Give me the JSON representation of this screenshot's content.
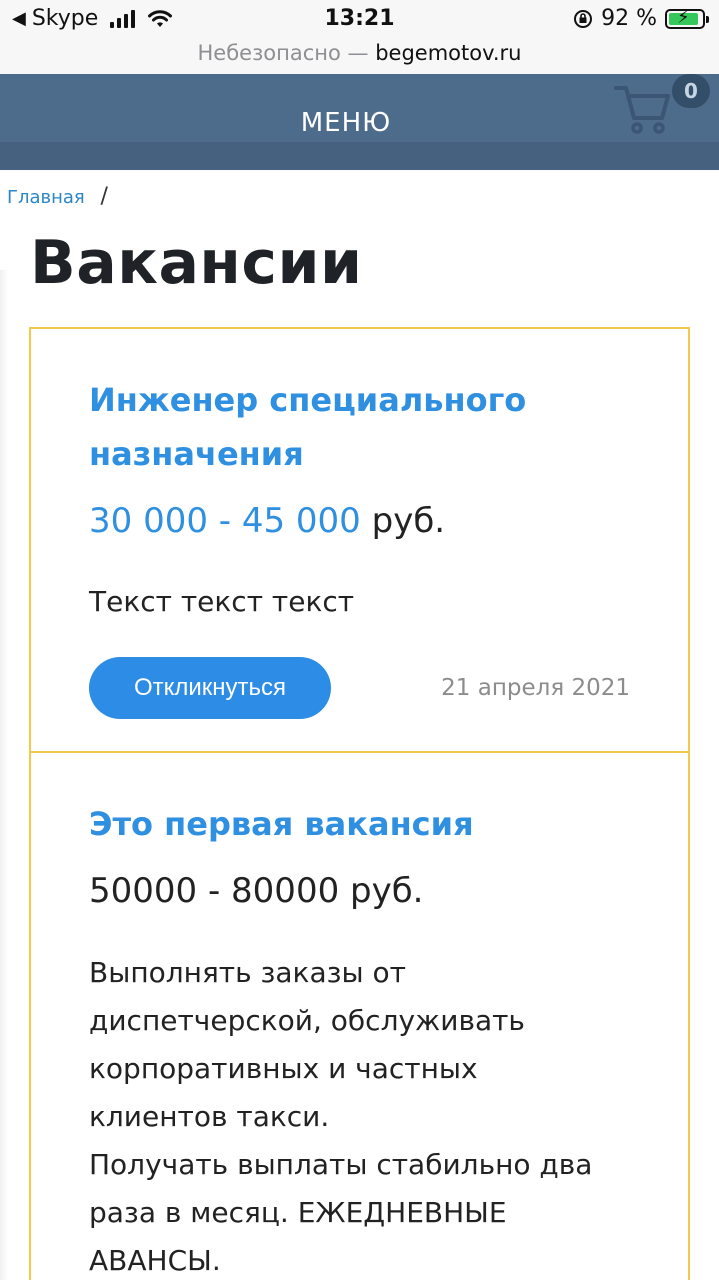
{
  "status_bar": {
    "back_app": "Skype",
    "time": "13:21",
    "battery_percent": "92 %",
    "battery_level": 0.92
  },
  "address_bar": {
    "security": "Небезопасно —",
    "domain": "begemotov.ru"
  },
  "header": {
    "menu_label": "МЕНЮ",
    "cart_count": "0"
  },
  "breadcrumb": {
    "home": "Главная",
    "separator": "/"
  },
  "page": {
    "title": "Вакансии"
  },
  "vacancies": [
    {
      "title": "Инженер специального назначения",
      "salary_range": "30 000 - 45 000",
      "currency": " руб.",
      "description": "Текст текст текст",
      "button_label": "Откликнуться",
      "date": "21 апреля 2021"
    },
    {
      "title": "Это первая вакансия",
      "salary_range": "50000 - 80000",
      "currency": " руб.",
      "description_lines": [
        "Выполнять заказы от",
        "диспетчерской, обслуживать",
        "корпоративных и частных",
        "клиентов такси.",
        "Получать выплаты стабильно два",
        "раза в месяц. ЕЖЕДНЕВНЫЕ",
        "АВАНСЫ."
      ]
    }
  ],
  "colors": {
    "header_bg": "#4d6b8b",
    "accent_blue": "#2f8fe0",
    "card_border": "#f2c94c",
    "button_bg": "#2d8ce6"
  }
}
